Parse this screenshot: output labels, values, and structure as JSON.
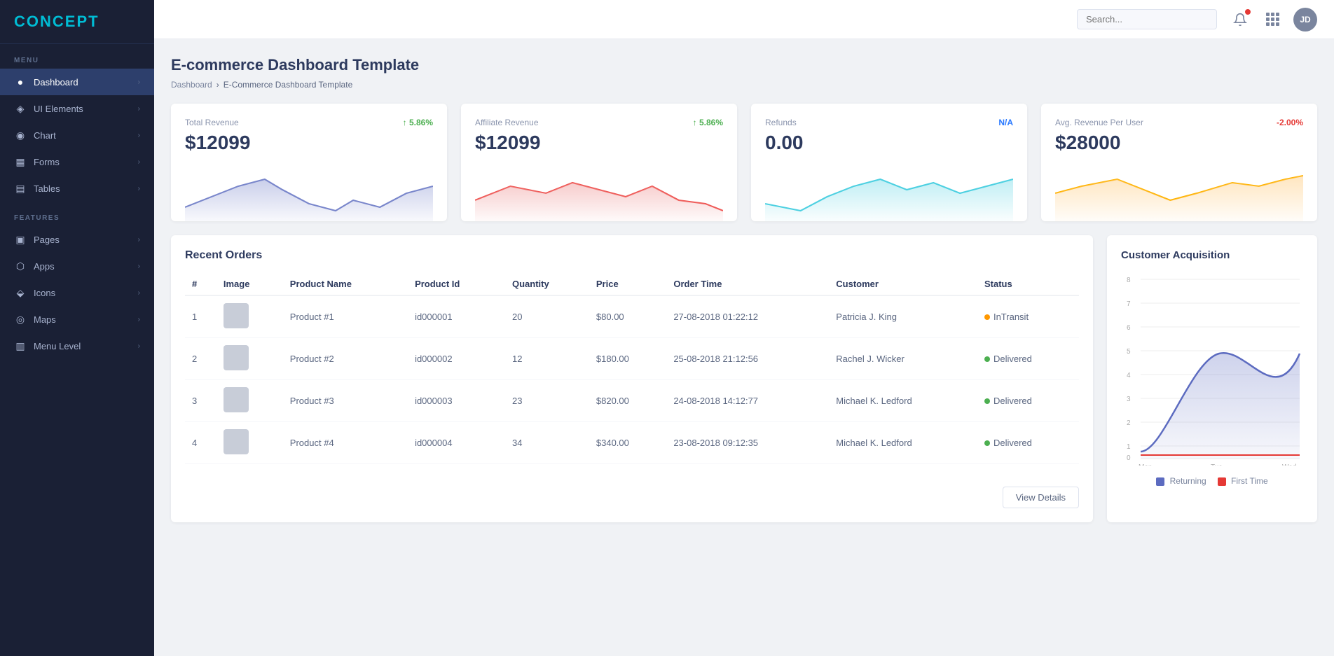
{
  "brand": "CONCEPT",
  "header": {
    "search_placeholder": "Search...",
    "avatar_initials": "JD"
  },
  "sidebar": {
    "menu_label": "MENU",
    "features_label": "FEATURES",
    "items": [
      {
        "id": "dashboard",
        "label": "Dashboard",
        "icon": "●",
        "active": true,
        "has_chevron": true
      },
      {
        "id": "ui-elements",
        "label": "UI Elements",
        "icon": "◈",
        "active": false,
        "has_chevron": true
      },
      {
        "id": "chart",
        "label": "Chart",
        "icon": "◉",
        "active": false,
        "has_chevron": true
      },
      {
        "id": "forms",
        "label": "Forms",
        "icon": "▦",
        "active": false,
        "has_chevron": true
      },
      {
        "id": "tables",
        "label": "Tables",
        "icon": "▤",
        "active": false,
        "has_chevron": true
      },
      {
        "id": "pages",
        "label": "Pages",
        "icon": "▣",
        "active": false,
        "has_chevron": true
      },
      {
        "id": "apps",
        "label": "Apps",
        "icon": "⬡",
        "active": false,
        "has_chevron": true
      },
      {
        "id": "icons",
        "label": "Icons",
        "icon": "⬙",
        "active": false,
        "has_chevron": true
      },
      {
        "id": "maps",
        "label": "Maps",
        "icon": "◎",
        "active": false,
        "has_chevron": true
      },
      {
        "id": "menu-level",
        "label": "Menu Level",
        "icon": "▥",
        "active": false,
        "has_chevron": true
      }
    ]
  },
  "page": {
    "title": "E-commerce Dashboard Template",
    "breadcrumb_home": "Dashboard",
    "breadcrumb_current": "E-Commerce Dashboard Template"
  },
  "stats": [
    {
      "id": "total-revenue",
      "label": "Total Revenue",
      "value": "$12099",
      "change": "↑ 5.86%",
      "change_type": "up",
      "color": "#7986cb"
    },
    {
      "id": "affiliate-revenue",
      "label": "Affiliate Revenue",
      "value": "$12099",
      "change": "↑ 5.86%",
      "change_type": "up",
      "color": "#ef9a9a"
    },
    {
      "id": "refunds",
      "label": "Refunds",
      "value": "0.00",
      "change": "N/A",
      "change_type": "na",
      "color": "#4dd0e1"
    },
    {
      "id": "avg-revenue",
      "label": "Avg. Revenue Per User",
      "value": "$28000",
      "change": "-2.00%",
      "change_type": "down",
      "color": "#ffcc80"
    }
  ],
  "orders": {
    "title": "Recent Orders",
    "columns": [
      "#",
      "Image",
      "Product Name",
      "Product Id",
      "Quantity",
      "Price",
      "Order Time",
      "Customer",
      "Status"
    ],
    "rows": [
      {
        "num": "1",
        "product_name": "Product #1",
        "product_id": "id000001",
        "quantity": "20",
        "price": "$80.00",
        "order_time": "27-08-2018 01:22:12",
        "customer": "Patricia J. King",
        "status": "InTransit",
        "status_type": "orange"
      },
      {
        "num": "2",
        "product_name": "Product #2",
        "product_id": "id000002",
        "quantity": "12",
        "price": "$180.00",
        "order_time": "25-08-2018 21:12:56",
        "customer": "Rachel J. Wicker",
        "status": "Delivered",
        "status_type": "green"
      },
      {
        "num": "3",
        "product_name": "Product #3",
        "product_id": "id000003",
        "quantity": "23",
        "price": "$820.00",
        "order_time": "24-08-2018 14:12:77",
        "customer": "Michael K. Ledford",
        "status": "Delivered",
        "status_type": "green"
      },
      {
        "num": "4",
        "product_name": "Product #4",
        "product_id": "id000004",
        "quantity": "34",
        "price": "$340.00",
        "order_time": "23-08-2018 09:12:35",
        "customer": "Michael K. Ledford",
        "status": "Delivered",
        "status_type": "green"
      }
    ],
    "view_details_label": "View Details"
  },
  "acquisition": {
    "title": "Customer Acquisition",
    "x_labels": [
      "Mon",
      "Tue",
      "Wed"
    ],
    "y_labels": [
      "0",
      "1",
      "2",
      "3",
      "4",
      "5",
      "6",
      "7",
      "8"
    ],
    "legend": [
      {
        "label": "Returning",
        "color": "#5c6bc0"
      },
      {
        "label": "First Time",
        "color": "#e53935"
      }
    ]
  }
}
